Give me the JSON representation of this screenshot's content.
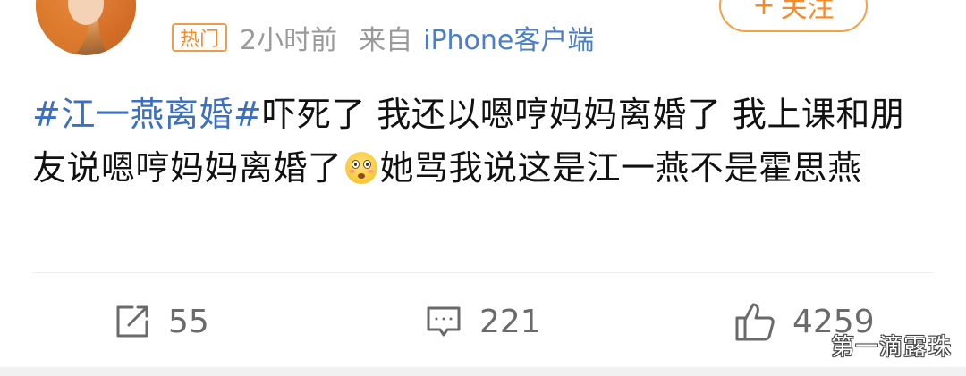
{
  "meta": {
    "badge": "热门",
    "time": "2小时前",
    "from_label": "来自",
    "source": "iPhone客户端"
  },
  "follow": {
    "plus": "+",
    "label": "关注"
  },
  "post": {
    "hashtag": "#江一燕离婚#",
    "text_before_emoji": "吓死了 我还以嗯哼妈妈离婚了 我上课和朋友说嗯哼妈妈离婚了",
    "emoji": "flushed-face-emoji",
    "text_after_emoji": "她骂我说这是江一燕不是霍思燕"
  },
  "actions": {
    "repost_count": "55",
    "comment_count": "221",
    "like_count": "4259"
  },
  "watermark": "第一滴露珠",
  "colors": {
    "hashtag": "#3b6fbf",
    "badge": "#f08a30",
    "source": "#4a7fc7",
    "follow": "#f58a28",
    "meta": "#9a9a9a",
    "action": "#6a6a6a"
  }
}
